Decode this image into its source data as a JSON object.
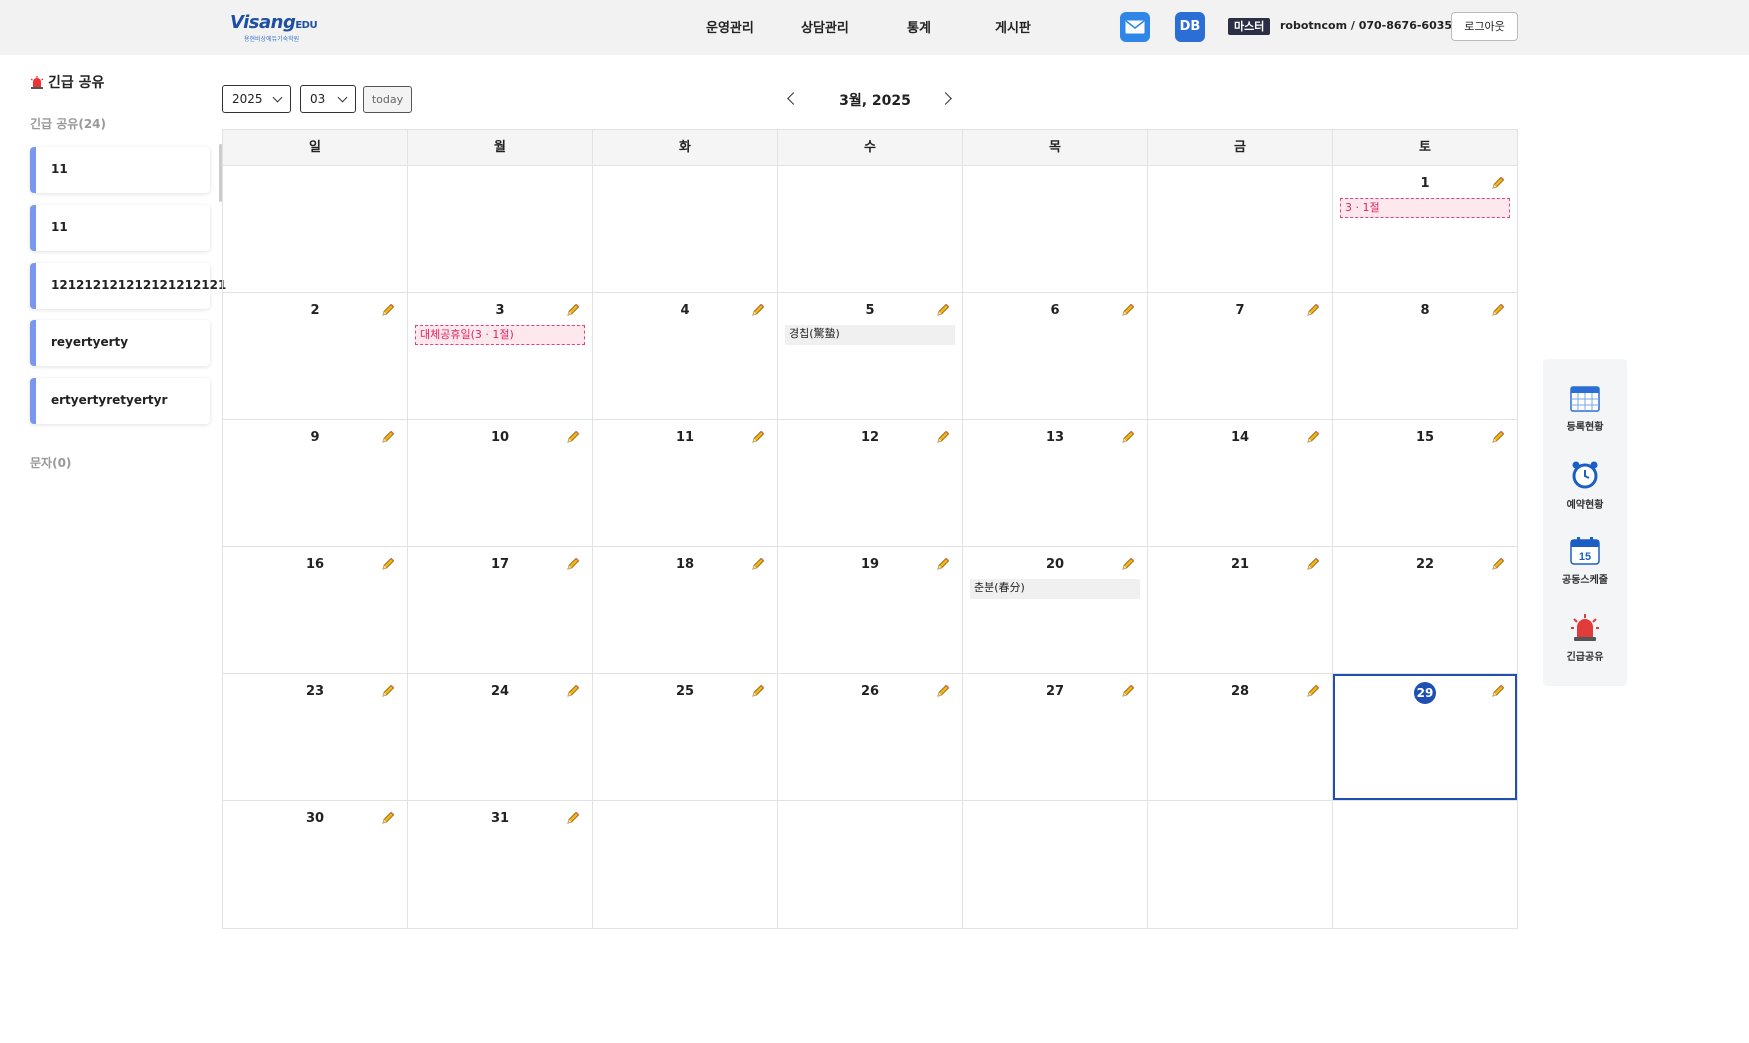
{
  "header": {
    "brand": "Visang",
    "brand_suffix": "EDU",
    "brand_tagline": "용현비상에듀기숙학원",
    "nav": [
      "운영관리",
      "상담관리",
      "통계",
      "게시판"
    ],
    "db_label": "DB",
    "role": "마스터",
    "user": "robotncom / 070-8676-6035",
    "logout": "로그아웃"
  },
  "sidebar": {
    "title": "긴급 공유",
    "section_label": "긴급 공유(24)",
    "items": [
      {
        "label": "11"
      },
      {
        "label": "11"
      },
      {
        "label": "121212121212121212121"
      },
      {
        "label": "reyertyerty"
      },
      {
        "label": "ertyertyretyertyr"
      }
    ],
    "sms_label": "문자(0)"
  },
  "controls": {
    "year": "2025",
    "month": "03",
    "today": "today",
    "title": "3월, 2025"
  },
  "weekdays": [
    "일",
    "월",
    "화",
    "수",
    "목",
    "금",
    "토"
  ],
  "weeks": [
    [
      null,
      null,
      null,
      null,
      null,
      null,
      {
        "d": "1",
        "event": "3 · 1절",
        "kind": "holiday"
      }
    ],
    [
      {
        "d": "2"
      },
      {
        "d": "3",
        "event": "대체공휴일(3 · 1절)",
        "kind": "holiday"
      },
      {
        "d": "4"
      },
      {
        "d": "5",
        "event": "경칩(驚蟄)",
        "kind": "plain"
      },
      {
        "d": "6"
      },
      {
        "d": "7"
      },
      {
        "d": "8"
      }
    ],
    [
      {
        "d": "9"
      },
      {
        "d": "10"
      },
      {
        "d": "11"
      },
      {
        "d": "12"
      },
      {
        "d": "13"
      },
      {
        "d": "14"
      },
      {
        "d": "15"
      }
    ],
    [
      {
        "d": "16"
      },
      {
        "d": "17"
      },
      {
        "d": "18"
      },
      {
        "d": "19"
      },
      {
        "d": "20",
        "event": "춘분(春分)",
        "kind": "plain"
      },
      {
        "d": "21"
      },
      {
        "d": "22"
      }
    ],
    [
      {
        "d": "23"
      },
      {
        "d": "24"
      },
      {
        "d": "25"
      },
      {
        "d": "26"
      },
      {
        "d": "27"
      },
      {
        "d": "28"
      },
      {
        "d": "29",
        "today": true
      }
    ],
    [
      {
        "d": "30"
      },
      {
        "d": "31"
      },
      null,
      null,
      null,
      null,
      null
    ]
  ],
  "quick_panel": [
    {
      "label": "등록현황",
      "icon": "calendar-grid-icon"
    },
    {
      "label": "예약현황",
      "icon": "alarm-clock-icon"
    },
    {
      "label": "공동스케줄",
      "icon": "calendar-15-icon"
    },
    {
      "label": "긴급공유",
      "icon": "siren-icon"
    }
  ],
  "colors": {
    "accent": "#1f4fb0",
    "card_border": "#7a97f0",
    "holiday_text": "#e0245e",
    "holiday_bg": "#fde8ee"
  }
}
